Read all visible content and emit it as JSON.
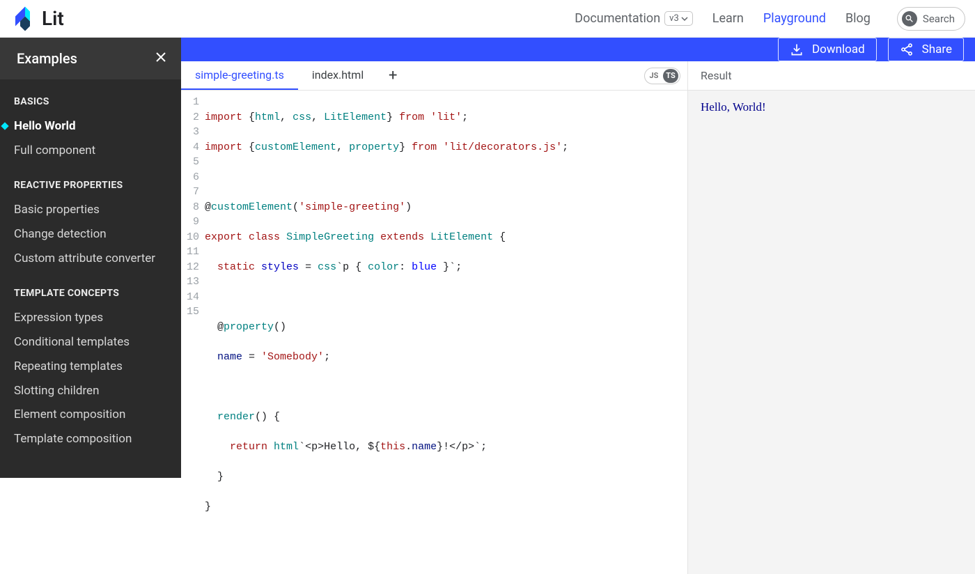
{
  "brand": "Lit",
  "nav": {
    "documentation": "Documentation",
    "version": "v3",
    "learn": "Learn",
    "playground": "Playground",
    "blog": "Blog",
    "search": "Search"
  },
  "sidebar": {
    "title": "Examples",
    "groups": [
      {
        "title": "BASICS",
        "items": [
          "Hello World",
          "Full component"
        ],
        "activeIndex": 0
      },
      {
        "title": "REACTIVE PROPERTIES",
        "items": [
          "Basic properties",
          "Change detection",
          "Custom attribute converter"
        ],
        "activeIndex": -1
      },
      {
        "title": "TEMPLATE CONCEPTS",
        "items": [
          "Expression types",
          "Conditional templates",
          "Repeating templates",
          "Slotting children",
          "Element composition",
          "Template composition"
        ],
        "activeIndex": -1
      }
    ]
  },
  "toolbar": {
    "download": "Download",
    "share": "Share"
  },
  "tabs": {
    "active": "simple-greeting.ts",
    "other": "index.html"
  },
  "lang": {
    "js": "JS",
    "ts": "TS",
    "selected": "TS"
  },
  "result": {
    "title": "Result",
    "output": "Hello, World!"
  },
  "code": {
    "line1": {
      "kw": "import",
      "p1": " {",
      "a": "html",
      "c1": ", ",
      "b": "css",
      "c2": ", ",
      "c": "LitElement",
      "p2": "} ",
      "from": "from",
      "sp": " ",
      "str": "'lit'",
      "end": ";"
    },
    "line2": {
      "kw": "import",
      "p1": " {",
      "a": "customElement",
      "c1": ", ",
      "b": "property",
      "p2": "} ",
      "from": "from",
      "sp": " ",
      "str": "'lit/decorators.js'",
      "end": ";"
    },
    "line4": {
      "at": "@",
      "dec": "customElement",
      "open": "(",
      "str": "'simple-greeting'",
      "close": ")"
    },
    "line5": {
      "exp": "export",
      "sp1": " ",
      "cls": "class",
      "sp2": " ",
      "name": "SimpleGreeting",
      "sp3": " ",
      "ext": "extends",
      "sp4": " ",
      "base": "LitElement",
      "brace": " {"
    },
    "line6": {
      "ind": "  ",
      "stat": "static",
      "sp1": " ",
      "prop": "styles",
      "eq": " = ",
      "fn": "css",
      "tick1": "`",
      "sel": "p { ",
      "cp": "color",
      "col": ": ",
      "cv": "blue",
      "end": " }`",
      "semi": ";"
    },
    "line8": {
      "ind": "  ",
      "at": "@",
      "dec": "property",
      "paren": "()"
    },
    "line9": {
      "ind": "  ",
      "prop": "name",
      "eq": " = ",
      "str": "'Somebody'",
      "semi": ";"
    },
    "line11": {
      "ind": "  ",
      "fn": "render",
      "rest": "() {"
    },
    "line12": {
      "ind": "    ",
      "ret": "return",
      "sp": " ",
      "fn": "html",
      "pre": "`<p>Hello, ${",
      "this": "this",
      "dot": ".",
      "prop": "name",
      "post": "}!</p>`",
      "semi": ";"
    },
    "line13": "  }",
    "line14": "}",
    "lineCount": 15
  }
}
